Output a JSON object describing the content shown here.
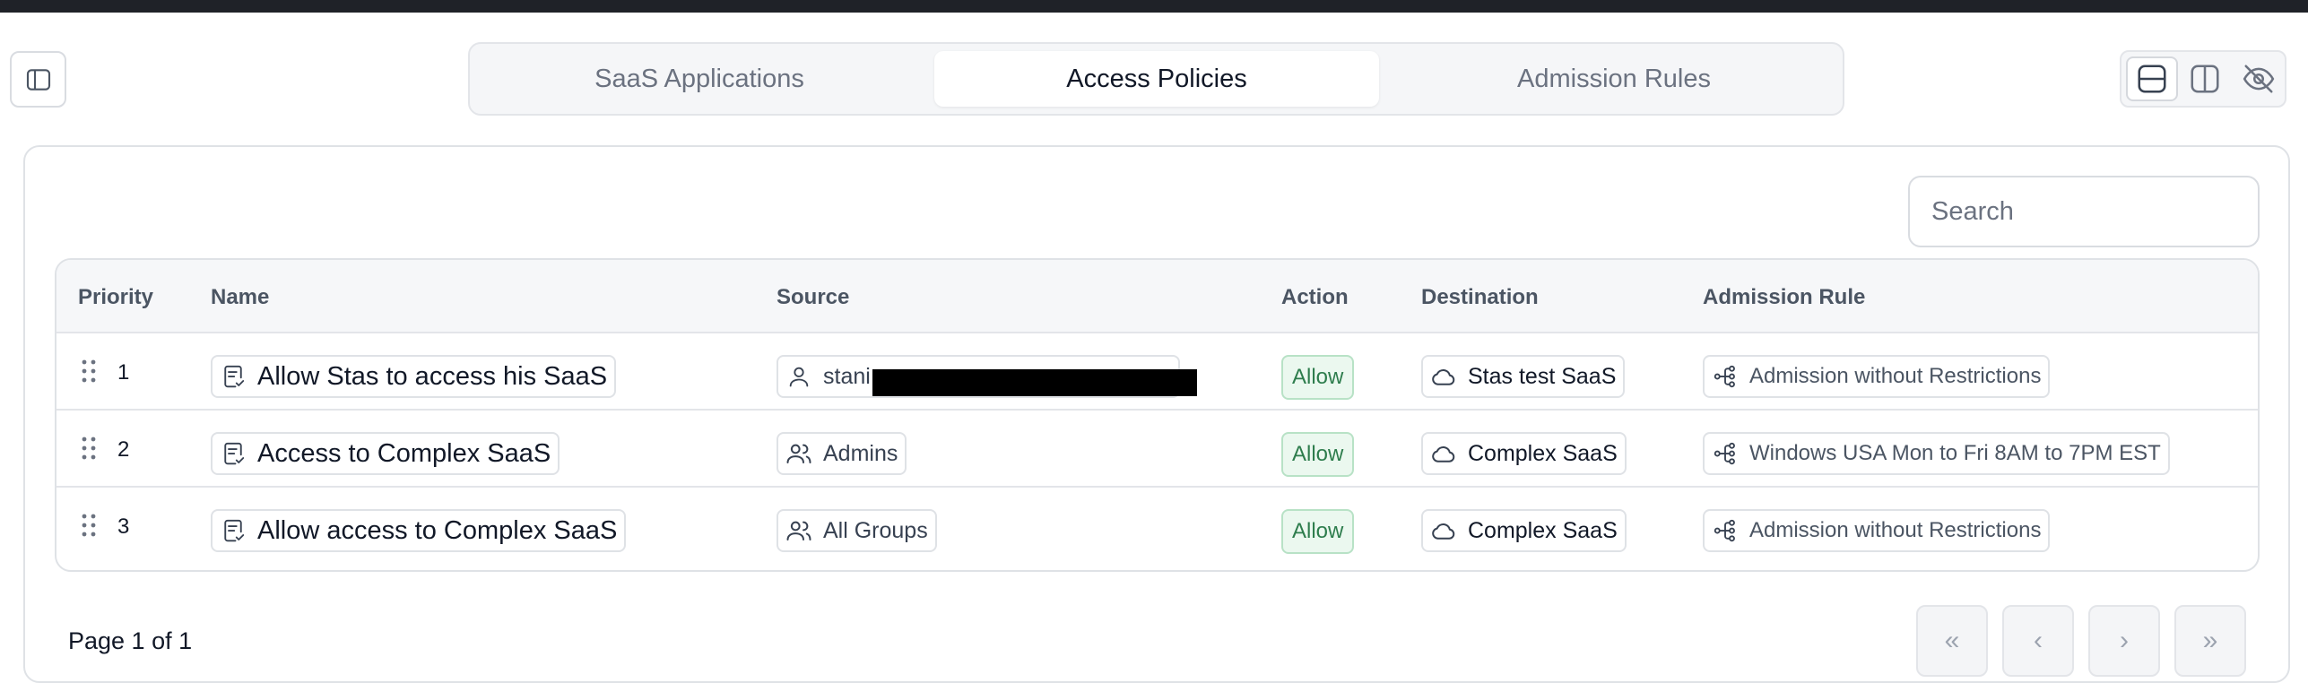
{
  "tabs": [
    {
      "label": "SaaS Applications",
      "active": false
    },
    {
      "label": "Access Policies",
      "active": true
    },
    {
      "label": "Admission Rules",
      "active": false
    }
  ],
  "search": {
    "placeholder": "Search",
    "value": ""
  },
  "table": {
    "columns": [
      "Priority",
      "Name",
      "Source",
      "Action",
      "Destination",
      "Admission Rule"
    ],
    "rows": [
      {
        "priority": "1",
        "name": "Allow Stas to access his SaaS",
        "source": "stani",
        "source_icon": "user-icon",
        "action": "Allow",
        "destination": "Stas test SaaS",
        "admission_rule": "Admission without Restrictions"
      },
      {
        "priority": "2",
        "name": "Access to Complex SaaS",
        "source": "Admins",
        "source_icon": "users-icon",
        "action": "Allow",
        "destination": "Complex SaaS",
        "admission_rule": "Windows USA Mon to Fri 8AM to 7PM EST"
      },
      {
        "priority": "3",
        "name": "Allow access to Complex SaaS",
        "source": "All Groups",
        "source_icon": "users-icon",
        "action": "Allow",
        "destination": "Complex SaaS",
        "admission_rule": "Admission without Restrictions"
      }
    ]
  },
  "pagination": {
    "page_info": "Page 1 of 1",
    "first": "«",
    "prev": "‹",
    "next": "›",
    "last": "»"
  },
  "colors": {
    "allow_bg": "#ebf8ef",
    "allow_text": "#2e7d4d",
    "border": "#dfe2e6",
    "header_bg": "#f6f7f9"
  }
}
